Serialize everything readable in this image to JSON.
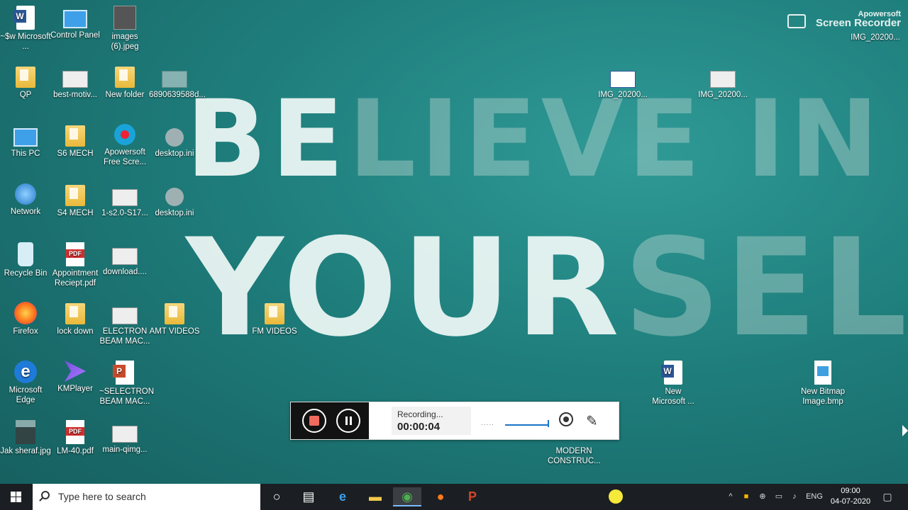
{
  "wallpaper": {
    "line1_bright": "BE",
    "line1_dim": "LIEVE IN",
    "line2_bright": "YOUR",
    "line2_dim": "SELF"
  },
  "watermark": {
    "brand_small": "Apowersoft",
    "brand_big": "Screen Recorder",
    "corner_file": "IMG_20200..."
  },
  "desktop_icons": {
    "sw_doc": "~$w Microsoft ...",
    "control_panel": "Control Panel",
    "images6": "images (6).jpeg",
    "qp": "QP",
    "best_motiv": "best-motiv...",
    "new_folder": "New folder",
    "img_6890": "6890639588d...",
    "this_pc": "This PC",
    "s6_mech": "S6 MECH",
    "apowersoft": "Apowersoft Free Scre...",
    "desktop_ini_1": "desktop.ini",
    "network": "Network",
    "s4_mech": "S4 MECH",
    "s2_file": "1-s2.0-S17...",
    "desktop_ini_2": "desktop.ini",
    "recycle_bin": "Recycle Bin",
    "appointment": "Appointment Reciept.pdf",
    "download": "download....",
    "firefox": "Firefox",
    "lock_down": "lock down",
    "electron": "ELECTRON BEAM MAC...",
    "amt_videos": "AMT VIDEOS",
    "fm_videos": "FM VIDEOS",
    "edge": "Microsoft Edge",
    "kmplayer": "KMPlayer",
    "selectron": "~SELECTRON BEAM MAC...",
    "jak_sheraf": "Jak sheraf.jpg",
    "lm40": "LM-40.pdf",
    "main_qimg": "main-qimg...",
    "img_a": "IMG_20200...",
    "img_b": "IMG_20200...",
    "new_word": "New Microsoft ...",
    "new_bitmap": "New Bitmap Image.bmp",
    "modern": "MODERN CONSTRUC..."
  },
  "recorder": {
    "status": "Recording...",
    "time": "00:00:04",
    "dots": "....."
  },
  "taskbar": {
    "search_placeholder": "Type here to search",
    "lang": "ENG",
    "time": "09:00",
    "date": "04-07-2020"
  },
  "colors": {
    "taskbar": "#1b1f23",
    "accent": "#1a73c7",
    "stop_red": "#f06a5e"
  }
}
